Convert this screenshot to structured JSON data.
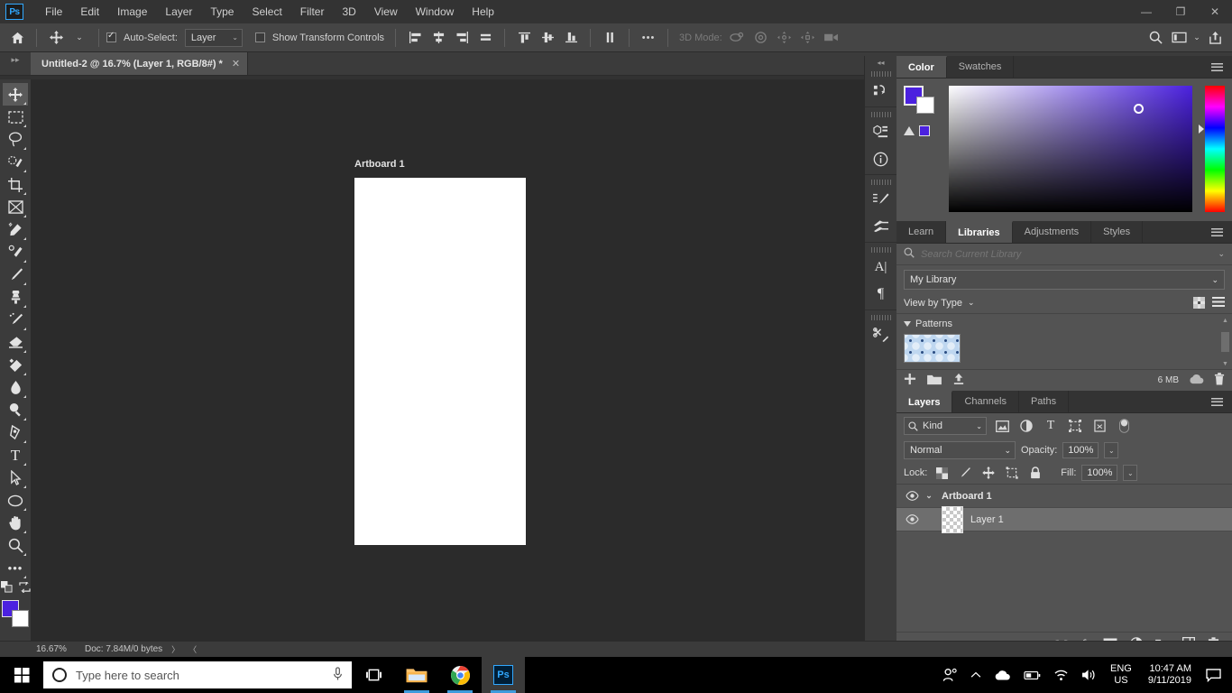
{
  "app": {
    "logo": "Ps",
    "menus": [
      "File",
      "Edit",
      "Image",
      "Layer",
      "Type",
      "Select",
      "Filter",
      "3D",
      "View",
      "Window",
      "Help"
    ],
    "window_buttons": {
      "minimize": "—",
      "restore": "❐",
      "close": "✕"
    }
  },
  "options_bar": {
    "home_icon": "home-icon",
    "tool_icon": "move-tool-icon",
    "tool_chevron": "⌄",
    "auto_select_label": "Auto-Select:",
    "auto_select_checked": true,
    "auto_select_value": "Layer",
    "show_transform_label": "Show Transform Controls",
    "show_transform_checked": false,
    "more_label": "•••",
    "mode_3d_label": "3D Mode:",
    "search_icon": "search-icon",
    "workspace_icon": "workspace-icon",
    "share_icon": "share-icon"
  },
  "document": {
    "tab_title": "Untitled-2 @ 16.7% (Layer 1, RGB/8#) *",
    "close_glyph": "✕",
    "collapse_glyph": "▸▸"
  },
  "canvas": {
    "artboard_label": "Artboard 1"
  },
  "tools": [
    {
      "name": "move-tool",
      "label": "Move Tool",
      "active": true
    },
    {
      "name": "marquee-tool",
      "label": "Rectangular Marquee Tool",
      "active": false
    },
    {
      "name": "lasso-tool",
      "label": "Lasso Tool",
      "active": false
    },
    {
      "name": "quick-selection-tool",
      "label": "Object Selection Tool",
      "active": false
    },
    {
      "name": "crop-tool",
      "label": "Crop Tool",
      "active": false
    },
    {
      "name": "frame-tool",
      "label": "Frame Tool",
      "active": false
    },
    {
      "name": "eyedropper-tool",
      "label": "Eyedropper Tool",
      "active": false
    },
    {
      "name": "spot-healing-tool",
      "label": "Spot Healing Brush Tool",
      "active": false
    },
    {
      "name": "brush-tool",
      "label": "Brush Tool",
      "active": false
    },
    {
      "name": "clone-stamp-tool",
      "label": "Clone Stamp Tool",
      "active": false
    },
    {
      "name": "history-brush-tool",
      "label": "History Brush Tool",
      "active": false
    },
    {
      "name": "eraser-tool",
      "label": "Eraser Tool",
      "active": false
    },
    {
      "name": "gradient-tool",
      "label": "Gradient Tool",
      "active": false
    },
    {
      "name": "blur-tool",
      "label": "Blur Tool",
      "active": false
    },
    {
      "name": "dodge-tool",
      "label": "Dodge Tool",
      "active": false
    },
    {
      "name": "pen-tool",
      "label": "Pen Tool",
      "active": false
    },
    {
      "name": "type-tool",
      "label": "Horizontal Type Tool",
      "active": false
    },
    {
      "name": "path-selection-tool",
      "label": "Path Selection Tool",
      "active": false
    },
    {
      "name": "ellipse-tool",
      "label": "Ellipse Tool",
      "active": false
    },
    {
      "name": "hand-tool",
      "label": "Hand Tool",
      "active": false
    },
    {
      "name": "zoom-tool",
      "label": "Zoom Tool",
      "active": false
    },
    {
      "name": "edit-toolbar",
      "label": "Edit Toolbar",
      "active": false
    }
  ],
  "toolbar_colors": {
    "foreground": "#4b21df",
    "background": "#ffffff",
    "default_icon": "default-colors-icon",
    "swap_icon": "swap-colors-icon"
  },
  "icon_dock": {
    "collapse_glyph": "◂◂",
    "icons": [
      "history-icon",
      "3d-icon",
      "info-icon",
      "brush-settings-icon",
      "brush-presets-icon",
      "character-icon",
      "paragraph-icon",
      "tool-presets-icon"
    ]
  },
  "color_panel": {
    "tabs": [
      {
        "label": "Color",
        "active": true
      },
      {
        "label": "Swatches",
        "active": false
      }
    ],
    "menu_icon": "panel-menu-icon",
    "foreground": "#4b21df",
    "background": "#ffffff",
    "gamut_warning_icon": "gamut-warning-icon",
    "gamut_swatch": "#4b21df"
  },
  "libraries_panel": {
    "tabs": [
      {
        "label": "Learn",
        "active": false
      },
      {
        "label": "Libraries",
        "active": true
      },
      {
        "label": "Adjustments",
        "active": false
      },
      {
        "label": "Styles",
        "active": false
      }
    ],
    "menu_icon": "panel-menu-icon",
    "search_placeholder": "Search Current Library",
    "search_value": "",
    "search_icon": "search-icon",
    "library_name": "My Library",
    "view_by_label": "View by Type",
    "grid_view_icon": "grid-view-icon",
    "list_view_icon": "list-view-icon",
    "group_label": "Patterns",
    "asset_name": "pattern-thumbnail",
    "size_label": "6 MB",
    "add_icon": "add-icon",
    "folder_icon": "folder-icon",
    "upload_icon": "upload-icon",
    "cloud_icon": "cloud-sync-icon",
    "delete_icon": "delete-icon"
  },
  "layers_panel": {
    "tabs": [
      {
        "label": "Layers",
        "active": true
      },
      {
        "label": "Channels",
        "active": false
      },
      {
        "label": "Paths",
        "active": false
      }
    ],
    "menu_icon": "panel-menu-icon",
    "filter_kind_label": "Kind",
    "filter_icons": [
      "pixel-filter-icon",
      "adjustment-filter-icon",
      "type-filter-icon",
      "shape-filter-icon",
      "smart-object-filter-icon"
    ],
    "filter_toggle_icon": "filter-toggle-icon",
    "blend_mode": "Normal",
    "opacity_label": "Opacity:",
    "opacity_value": "100%",
    "lock_label": "Lock:",
    "lock_icons": [
      "lock-transparency-icon",
      "lock-image-icon",
      "lock-position-icon",
      "lock-artboard-icon",
      "lock-all-icon"
    ],
    "fill_label": "Fill:",
    "fill_value": "100%",
    "layers": [
      {
        "name": "Artboard 1",
        "type": "group",
        "visible": true,
        "selected": false,
        "expand_glyph": "⌄"
      },
      {
        "name": "Layer 1",
        "type": "layer",
        "visible": true,
        "selected": true
      }
    ],
    "eye_glyph": "👁",
    "footer_icons": [
      "link-layers-icon",
      "layer-style-icon",
      "layer-mask-icon",
      "adjustment-layer-icon",
      "new-group-icon",
      "new-layer-icon",
      "delete-layer-icon"
    ],
    "layer_style_label": "fx"
  },
  "status_bar": {
    "zoom": "16.67%",
    "doc_info": "Doc: 7.84M/0 bytes",
    "next_glyph": "〉",
    "prev_glyph": "〈"
  },
  "taskbar": {
    "start_icon": "windows-start-icon",
    "search_placeholder": "Type here to search",
    "search_value": "",
    "cortana_icon": "cortana-circle-icon",
    "mic_icon": "microphone-icon",
    "taskview_icon": "task-view-icon",
    "apps": [
      {
        "name": "file-explorer",
        "running": true
      },
      {
        "name": "google-chrome",
        "running": true
      },
      {
        "name": "photoshop",
        "running": true,
        "active": true
      }
    ],
    "tray": {
      "people_icon": "people-icon",
      "chevron_icon": "show-hidden-icons-icon",
      "onedrive_icon": "onedrive-icon",
      "battery_icon": "battery-icon",
      "wifi_icon": "wifi-icon",
      "volume_icon": "volume-icon",
      "language_line1": "ENG",
      "language_line2": "US",
      "time": "10:47 AM",
      "date": "9/11/2019",
      "action_center_icon": "action-center-icon"
    }
  }
}
